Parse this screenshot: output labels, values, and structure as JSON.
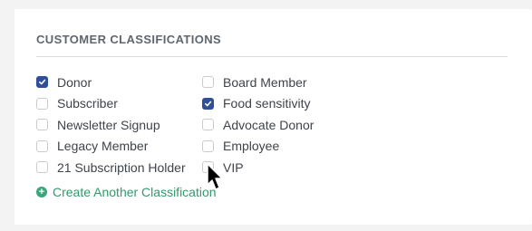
{
  "section": {
    "title": "CUSTOMER CLASSIFICATIONS",
    "left_items": [
      {
        "label": "Donor",
        "checked": true
      },
      {
        "label": "Subscriber",
        "checked": false
      },
      {
        "label": "Newsletter Signup",
        "checked": false
      },
      {
        "label": "Legacy Member",
        "checked": false
      },
      {
        "label": "21 Subscription Holder",
        "checked": false
      }
    ],
    "right_items": [
      {
        "label": "Board Member",
        "checked": false
      },
      {
        "label": "Food sensitivity",
        "checked": true
      },
      {
        "label": "Advocate Donor",
        "checked": false
      },
      {
        "label": "Employee",
        "checked": false
      },
      {
        "label": "VIP",
        "checked": false
      }
    ],
    "create_link": "Create Another Classification"
  },
  "colors": {
    "checked": "#2f4f98",
    "link": "#2f9a6b",
    "title": "#5f6670"
  },
  "icons": {
    "checkmark": "checkmark-icon",
    "add": "plus-circle-icon",
    "pointer": "mouse-pointer-icon"
  }
}
